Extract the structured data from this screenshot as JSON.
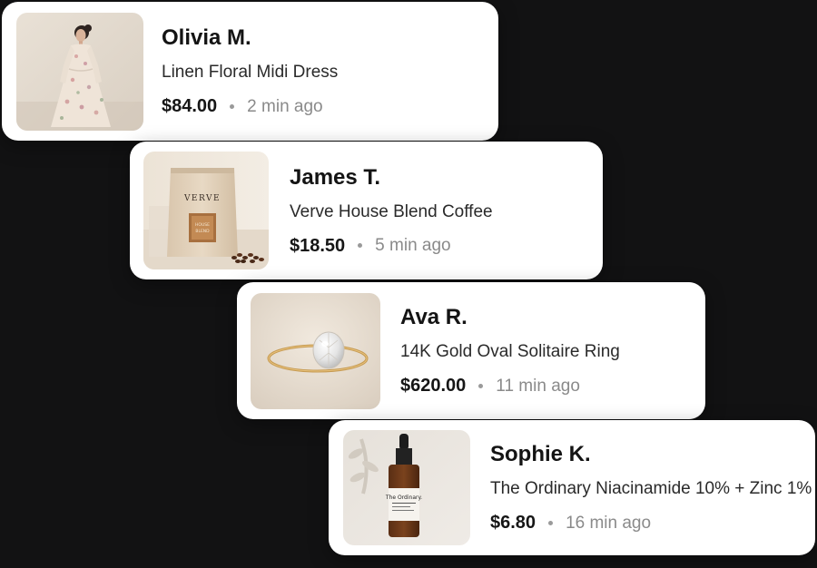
{
  "notifications": [
    {
      "name": "Olivia M.",
      "product": "Linen Floral Midi Dress",
      "price": "$84.00",
      "time": "2 min ago",
      "image": "floral-dress-photo"
    },
    {
      "name": "James T.",
      "product": "Verve House Blend Coffee",
      "price": "$18.50",
      "time": "5 min ago",
      "image": "coffee-bag-photo",
      "bag_brand": "VERVE",
      "bag_label": "HOUSE BLEND"
    },
    {
      "name": "Ava R.",
      "product": "14K Gold Oval Solitaire Ring",
      "price": "$620.00",
      "time": "11 min ago",
      "image": "gold-ring-photo"
    },
    {
      "name": "Sophie K.",
      "product": "The Ordinary Niacinamide 10% + Zinc 1%",
      "price": "$6.80",
      "time": "16 min ago",
      "image": "serum-bottle-photo",
      "bottle_brand": "The Ordinary."
    }
  ],
  "colors": {
    "background": "#121213",
    "card": "#ffffff",
    "name_text": "#141414",
    "time_text": "#8a8a8a"
  }
}
